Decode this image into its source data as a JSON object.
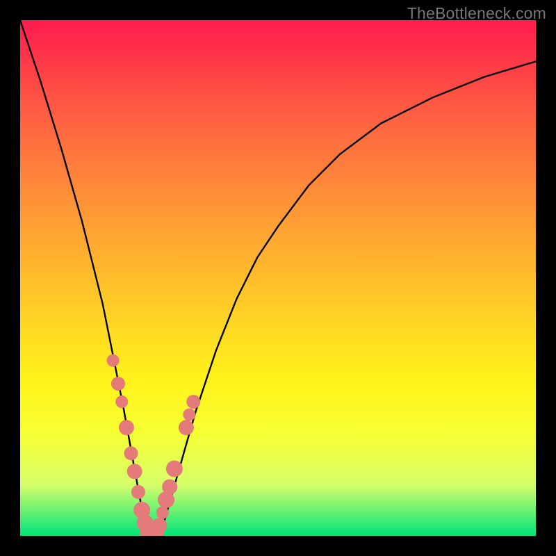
{
  "watermark": "TheBottleneck.com",
  "chart_data": {
    "type": "line",
    "title": "",
    "xlabel": "",
    "ylabel": "",
    "xlim": [
      0,
      100
    ],
    "ylim": [
      0,
      100
    ],
    "curve": {
      "x": [
        0,
        4,
        8,
        12,
        16,
        18,
        20,
        22,
        24,
        25,
        26,
        27,
        28,
        30,
        32,
        34,
        38,
        42,
        46,
        50,
        56,
        62,
        70,
        80,
        90,
        100
      ],
      "y": [
        100,
        88,
        75,
        61,
        45,
        35,
        25,
        14,
        3,
        0,
        0,
        0,
        3,
        10,
        17,
        24,
        36,
        46,
        54,
        60,
        68,
        74,
        80,
        85,
        89,
        92
      ]
    },
    "series": [
      {
        "name": "left-arm-dots",
        "x": [
          18.0,
          19.0,
          19.7,
          20.6,
          21.5,
          22.2,
          22.9,
          23.6,
          24.2,
          24.8
        ],
        "y": [
          34.0,
          29.5,
          26.0,
          21.0,
          16.0,
          12.5,
          8.5,
          5.0,
          2.5,
          0.5
        ],
        "r": [
          9,
          10,
          9,
          11,
          10,
          11,
          10,
          12,
          12,
          12
        ]
      },
      {
        "name": "right-arm-dots",
        "x": [
          26.2,
          27.0,
          27.6,
          28.3,
          29.0,
          29.9,
          32.2,
          32.8,
          33.6
        ],
        "y": [
          0.5,
          2.0,
          4.5,
          7.0,
          9.5,
          13.0,
          21.0,
          23.5,
          26.0
        ],
        "r": [
          12,
          11,
          9,
          12,
          11,
          12,
          11,
          9,
          10
        ]
      }
    ]
  }
}
